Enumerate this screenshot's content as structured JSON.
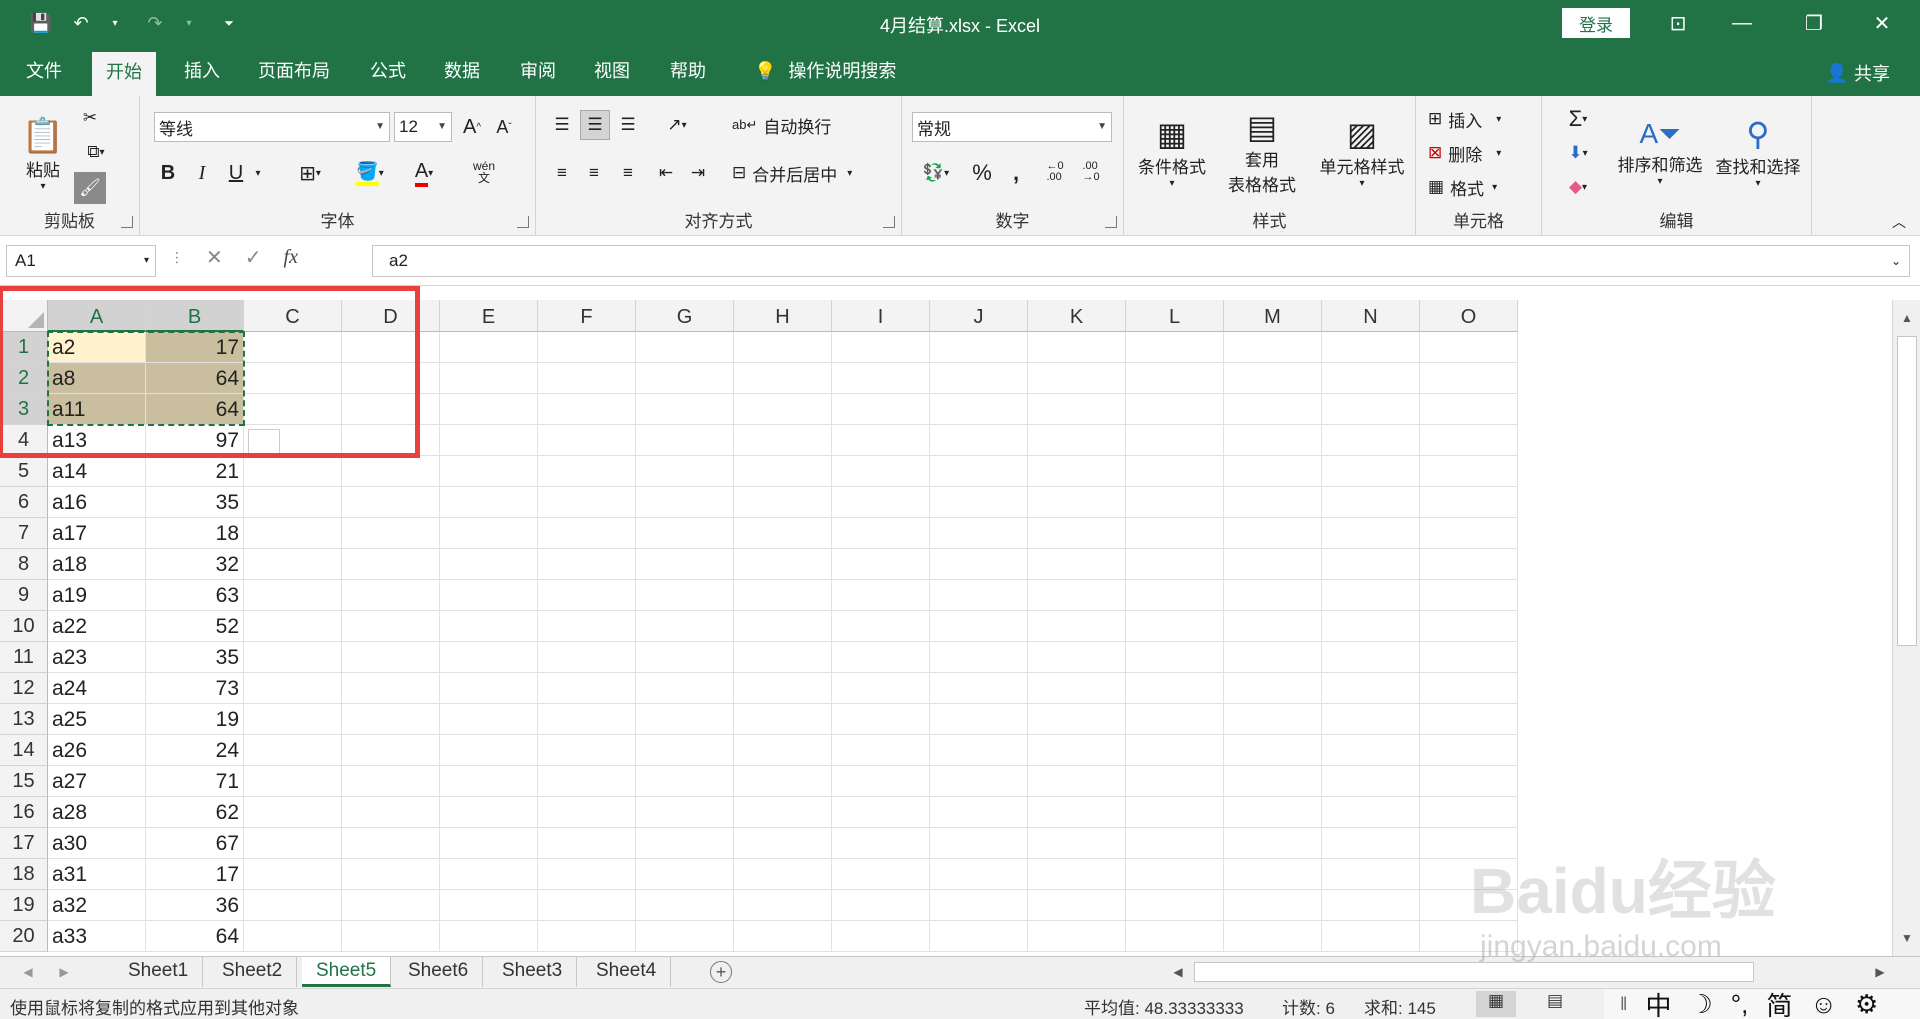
{
  "window": {
    "title": "4月结算.xlsx  -  Excel",
    "login_label": "登录"
  },
  "tabs": [
    "文件",
    "开始",
    "插入",
    "页面布局",
    "公式",
    "数据",
    "审阅",
    "视图",
    "帮助",
    "操作说明搜索"
  ],
  "share_label": "共享",
  "ribbon": {
    "clipboard": {
      "paste": "粘贴",
      "label": "剪贴板"
    },
    "font": {
      "name": "等线",
      "size": "12",
      "label": "字体",
      "bold": "B",
      "italic": "I",
      "underline": "U",
      "wen": "wén\n文"
    },
    "alignment": {
      "wrap": "自动换行",
      "merge": "合并后居中",
      "label": "对齐方式"
    },
    "number": {
      "format": "常规",
      "percent": "%",
      "comma": ",",
      "label": "数字"
    },
    "styles": {
      "conditional": "条件格式",
      "table_format_1": "套用",
      "table_format_2": "表格格式",
      "cell_styles": "单元格样式",
      "label": "样式"
    },
    "cells": {
      "insert": "插入",
      "delete": "删除",
      "format": "格式",
      "label": "单元格"
    },
    "editing": {
      "sort": "排序和筛选",
      "find": "查找和选择",
      "label": "编辑"
    }
  },
  "formula_bar": {
    "name_box": "A1",
    "content": "a2"
  },
  "columns": [
    "A",
    "B",
    "C",
    "D",
    "E",
    "F",
    "G",
    "H",
    "I",
    "J",
    "K",
    "L",
    "M",
    "N",
    "O"
  ],
  "rows": [
    {
      "n": "1",
      "a": "a2",
      "b": "17"
    },
    {
      "n": "2",
      "a": "a8",
      "b": "64"
    },
    {
      "n": "3",
      "a": "a11",
      "b": "64"
    },
    {
      "n": "4",
      "a": "a13",
      "b": "97"
    },
    {
      "n": "5",
      "a": "a14",
      "b": "21"
    },
    {
      "n": "6",
      "a": "a16",
      "b": "35"
    },
    {
      "n": "7",
      "a": "a17",
      "b": "18"
    },
    {
      "n": "8",
      "a": "a18",
      "b": "32"
    },
    {
      "n": "9",
      "a": "a19",
      "b": "63"
    },
    {
      "n": "10",
      "a": "a22",
      "b": "52"
    },
    {
      "n": "11",
      "a": "a23",
      "b": "35"
    },
    {
      "n": "12",
      "a": "a24",
      "b": "73"
    },
    {
      "n": "13",
      "a": "a25",
      "b": "19"
    },
    {
      "n": "14",
      "a": "a26",
      "b": "24"
    },
    {
      "n": "15",
      "a": "a27",
      "b": "71"
    },
    {
      "n": "16",
      "a": "a28",
      "b": "62"
    },
    {
      "n": "17",
      "a": "a30",
      "b": "67"
    },
    {
      "n": "18",
      "a": "a31",
      "b": "17"
    },
    {
      "n": "19",
      "a": "a32",
      "b": "36"
    },
    {
      "n": "20",
      "a": "a33",
      "b": "64"
    }
  ],
  "sheets": [
    {
      "name": "Sheet1",
      "active": false
    },
    {
      "name": "Sheet2",
      "active": false
    },
    {
      "name": "Sheet5",
      "active": true
    },
    {
      "name": "Sheet6",
      "active": false
    },
    {
      "name": "Sheet3",
      "active": false
    },
    {
      "name": "Sheet4",
      "active": false
    }
  ],
  "status": {
    "message": "使用鼠标将复制的格式应用到其他对象",
    "average": "平均值: 48.33333333",
    "count": "计数: 6",
    "sum": "求和: 145"
  },
  "ime": [
    "中",
    "☽",
    "°,",
    "简",
    "☺",
    "⚙"
  ],
  "watermark": {
    "main": "Baidu经验",
    "sub": "jingyan.baidu.com"
  },
  "colors": {
    "accent": "#217346",
    "highlight": "#c9bf9f",
    "annotation": "#e84040"
  }
}
